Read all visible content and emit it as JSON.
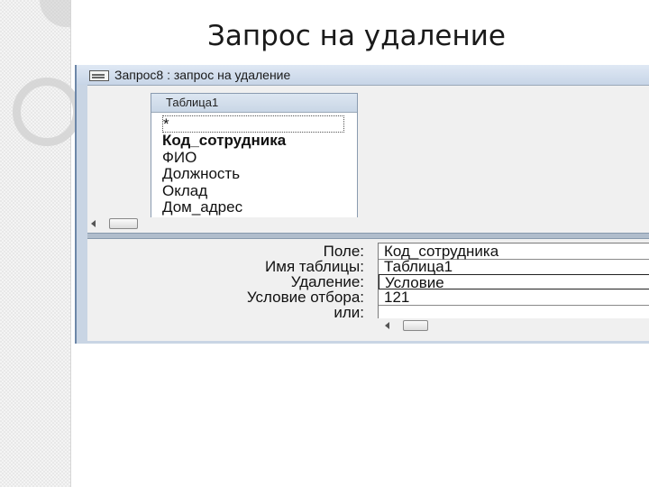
{
  "slide": {
    "title": "Запрос на удаление"
  },
  "window": {
    "title": "Запрос8 : запрос на удаление",
    "icon": "query-design-icon"
  },
  "table": {
    "name": "Таблица1",
    "fields": [
      "*",
      "Код_сотрудника",
      "ФИО",
      "Должность",
      "Оклад",
      "Дом_адрес"
    ],
    "key_field": "Код_сотрудника"
  },
  "grid": {
    "labels": {
      "field": "Поле:",
      "table": "Имя таблицы:",
      "delete": "Удаление:",
      "criteria": "Условие отбора:",
      "or": "или:"
    },
    "column": {
      "field": "Код_сотрудника",
      "table": "Таблица1",
      "delete": "Условие",
      "criteria": "121",
      "or": ""
    }
  },
  "colors": {
    "window_frame": "#c9d5e4",
    "pane": "#f0f0f0"
  }
}
